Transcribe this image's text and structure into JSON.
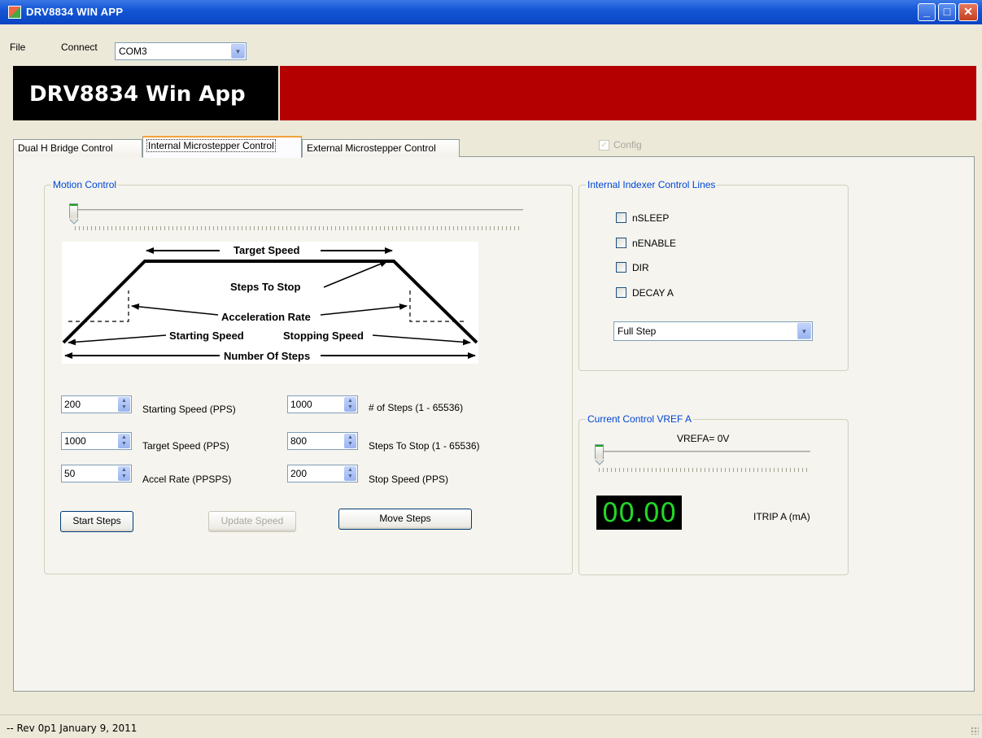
{
  "window": {
    "title": "DRV8834 WIN APP"
  },
  "menu": {
    "file": "File",
    "connect": "Connect",
    "com_port": "COM3"
  },
  "banner": {
    "title": "DRV8834 Win App",
    "red_color": "#b40000"
  },
  "tabs": [
    {
      "label": "Dual H Bridge Control"
    },
    {
      "label": "Internal Microstepper Control"
    },
    {
      "label": "External Microstepper Control"
    }
  ],
  "config": {
    "label": "Config",
    "checked": true
  },
  "motion_control": {
    "title": "Motion Control",
    "slider_value": 0,
    "diagram": {
      "target_speed": "Target Speed",
      "steps_to_stop": "Steps To Stop",
      "acceleration_rate": "Acceleration Rate",
      "starting_speed": "Starting Speed",
      "stopping_speed": "Stopping Speed",
      "number_of_steps": "Number Of Steps"
    },
    "fields": {
      "starting_speed": {
        "value": "200",
        "label": "Starting Speed (PPS)"
      },
      "target_speed": {
        "value": "1000",
        "label": "Target Speed (PPS)"
      },
      "accel_rate": {
        "value": "50",
        "label": "Accel Rate (PPSPS)"
      },
      "num_steps": {
        "value": "1000",
        "label": "# of Steps (1 - 65536)"
      },
      "steps_to_stop": {
        "value": "800",
        "label": "Steps To Stop  (1 - 65536)"
      },
      "stop_speed": {
        "value": "200",
        "label": "Stop Speed (PPS)"
      }
    },
    "buttons": {
      "start_steps": "Start Steps",
      "update_speed": "Update Speed",
      "move_steps": "Move Steps"
    }
  },
  "indexer": {
    "title": "Internal Indexer Control Lines",
    "checkboxes": [
      {
        "label": "nSLEEP",
        "checked": false
      },
      {
        "label": "nENABLE",
        "checked": false
      },
      {
        "label": "DIR",
        "checked": false
      },
      {
        "label": "DECAY A",
        "checked": false
      }
    ],
    "step_mode": "Full Step"
  },
  "current_control": {
    "title": "Current Control VREF A",
    "vref_label": "VREFA= 0V",
    "slider_value": 0,
    "display": "00.00",
    "itrip_label": "ITRIP A (mA)"
  },
  "status": {
    "text": "--  Rev 0p1 January 9, 2011"
  }
}
